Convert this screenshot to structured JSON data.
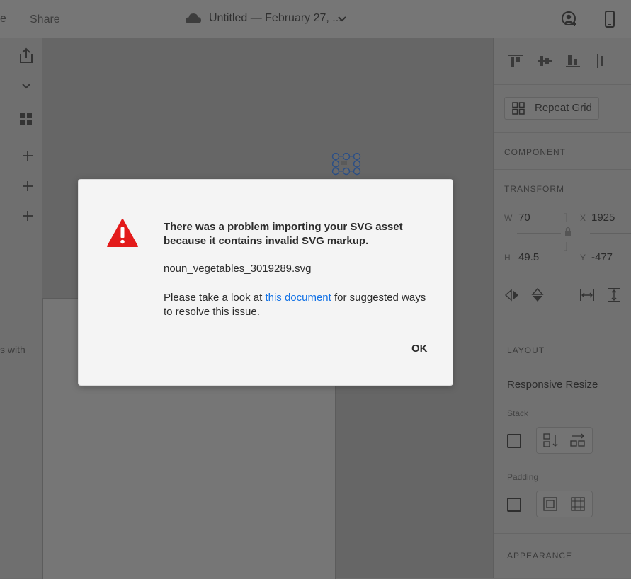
{
  "topbar": {
    "edge_text": "e",
    "share_label": "Share",
    "doc_title": "Untitled — February 27, ...",
    "icons": [
      "cloud-icon",
      "chevron-down-icon",
      "user-add-icon",
      "phone-preview-icon"
    ]
  },
  "left_toolbar": {
    "icons": [
      "share-icon",
      "chevron-down-icon",
      "grid-icon",
      "plus-icon",
      "plus-icon",
      "plus-icon"
    ],
    "partial_text": "s with"
  },
  "right_panel": {
    "align_icons": [
      "align-top-icon",
      "align-middle-icon",
      "align-bottom-icon",
      "align-left-icon"
    ],
    "repeat_grid_label": "Repeat Grid",
    "component_title": "COMPONENT",
    "transform_title": "TRANSFORM",
    "w_label": "W",
    "w_value": "70",
    "x_label": "X",
    "x_value": "1925",
    "h_label": "H",
    "h_value": "49.5",
    "y_label": "Y",
    "y_value": "-477",
    "layout_title": "LAYOUT",
    "responsive_resize": "Responsive Resize",
    "stack_label": "Stack",
    "padding_label": "Padding",
    "appearance_title": "APPEARANCE"
  },
  "dialog": {
    "title": "There was a problem importing your SVG asset because it contains invalid SVG markup.",
    "filename": "noun_vegetables_3019289.svg",
    "help_before": "Please take a look at ",
    "help_link": "this document",
    "help_after": " for suggested ways to resolve this issue.",
    "ok_label": "OK",
    "accent_color": "#1473e6",
    "warning_color": "#e31b1b"
  }
}
